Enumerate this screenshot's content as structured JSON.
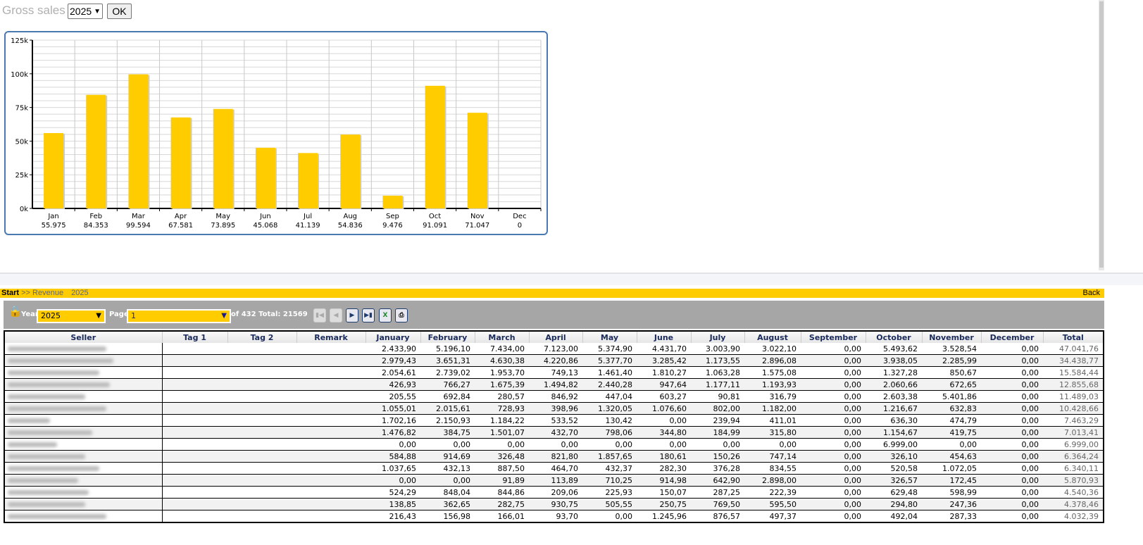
{
  "header": {
    "title": "Gross sales",
    "year": "2025",
    "ok_label": "OK"
  },
  "chart_data": {
    "type": "bar",
    "categories": [
      "Jan",
      "Feb",
      "Mar",
      "Apr",
      "May",
      "Jun",
      "Jul",
      "Aug",
      "Sep",
      "Oct",
      "Nov",
      "Dec"
    ],
    "values": [
      55975,
      84353,
      99594,
      67581,
      73895,
      45068,
      41139,
      54836,
      9476,
      91091,
      71047,
      0
    ],
    "value_labels": [
      "55.975",
      "84.353",
      "99.594",
      "67.581",
      "73.895",
      "45.068",
      "41.139",
      "54.836",
      "9.476",
      "91.091",
      "71.047",
      "0"
    ],
    "yticks": [
      "0k",
      "25k",
      "50k",
      "75k",
      "100k",
      "125k"
    ],
    "ylim": [
      0,
      125000
    ],
    "bar_color": "#ffcc00",
    "grid": true
  },
  "breadcrumb": {
    "start": "Start",
    "sep": ">>",
    "revenue": "Revenue",
    "year": "2025",
    "back": "Back"
  },
  "toolbar": {
    "year_label": "Year",
    "year": "2025",
    "page_label": "Page",
    "page": "1",
    "of_label": "of",
    "pages": "432",
    "total_label": "Total:",
    "total": "21569"
  },
  "table": {
    "columns": [
      "Seller",
      "Tag 1",
      "Tag 2",
      "Remark",
      "January",
      "February",
      "March",
      "April",
      "May",
      "June",
      "July",
      "August",
      "September",
      "October",
      "November",
      "December",
      "Total"
    ],
    "rows": [
      [
        "2.433,90",
        "5.196,10",
        "7.434,00",
        "7.123,00",
        "5.374,90",
        "4.431,70",
        "3.003,90",
        "3.022,10",
        "0,00",
        "5.493,62",
        "3.528,54",
        "0,00",
        "47.041,76"
      ],
      [
        "2.979,43",
        "3.651,31",
        "4.630,38",
        "4.220,86",
        "5.377,70",
        "3.285,42",
        "1.173,55",
        "2.896,08",
        "0,00",
        "3.938,05",
        "2.285,99",
        "0,00",
        "34.438,77"
      ],
      [
        "2.054,61",
        "2.739,02",
        "1.953,70",
        "749,13",
        "1.461,40",
        "1.810,27",
        "1.063,28",
        "1.575,08",
        "0,00",
        "1.327,28",
        "850,67",
        "0,00",
        "15.584,44"
      ],
      [
        "426,93",
        "766,27",
        "1.675,39",
        "1.494,82",
        "2.440,28",
        "947,64",
        "1.177,11",
        "1.193,93",
        "0,00",
        "2.060,66",
        "672,65",
        "0,00",
        "12.855,68"
      ],
      [
        "205,55",
        "692,84",
        "280,57",
        "846,92",
        "447,04",
        "603,27",
        "90,81",
        "316,79",
        "0,00",
        "2.603,38",
        "5.401,86",
        "0,00",
        "11.489,03"
      ],
      [
        "1.055,01",
        "2.015,61",
        "728,93",
        "398,96",
        "1.320,05",
        "1.076,60",
        "802,00",
        "1.182,00",
        "0,00",
        "1.216,67",
        "632,83",
        "0,00",
        "10.428,66"
      ],
      [
        "1.702,16",
        "2.150,93",
        "1.184,22",
        "533,52",
        "130,42",
        "0,00",
        "239,94",
        "411,01",
        "0,00",
        "636,30",
        "474,79",
        "0,00",
        "7.463,29"
      ],
      [
        "1.476,82",
        "384,75",
        "1.501,07",
        "432,70",
        "798,06",
        "344,80",
        "184,99",
        "315,80",
        "0,00",
        "1.154,67",
        "419,75",
        "0,00",
        "7.013,41"
      ],
      [
        "0,00",
        "0,00",
        "0,00",
        "0,00",
        "0,00",
        "0,00",
        "0,00",
        "0,00",
        "0,00",
        "6.999,00",
        "0,00",
        "0,00",
        "6.999,00"
      ],
      [
        "584,88",
        "914,69",
        "326,48",
        "821,80",
        "1.857,65",
        "180,61",
        "150,26",
        "747,14",
        "0,00",
        "326,10",
        "454,63",
        "0,00",
        "6.364,24"
      ],
      [
        "1.037,65",
        "432,13",
        "887,50",
        "464,70",
        "432,37",
        "282,30",
        "376,28",
        "834,55",
        "0,00",
        "520,58",
        "1.072,05",
        "0,00",
        "6.340,11"
      ],
      [
        "0,00",
        "0,00",
        "91,89",
        "113,89",
        "710,25",
        "914,98",
        "642,90",
        "2.898,00",
        "0,00",
        "326,57",
        "172,45",
        "0,00",
        "5.870,93"
      ],
      [
        "524,29",
        "848,04",
        "844,86",
        "209,06",
        "225,93",
        "150,07",
        "287,25",
        "222,39",
        "0,00",
        "629,48",
        "598,99",
        "0,00",
        "4.540,36"
      ],
      [
        "138,85",
        "362,65",
        "282,75",
        "930,75",
        "505,55",
        "250,75",
        "769,50",
        "595,50",
        "0,00",
        "294,80",
        "247,36",
        "0,00",
        "4.378,46"
      ],
      [
        "216,43",
        "156,98",
        "166,01",
        "93,70",
        "0,00",
        "1.245,96",
        "876,57",
        "497,37",
        "0,00",
        "492,04",
        "287,33",
        "0,00",
        "4.032,39"
      ]
    ]
  }
}
